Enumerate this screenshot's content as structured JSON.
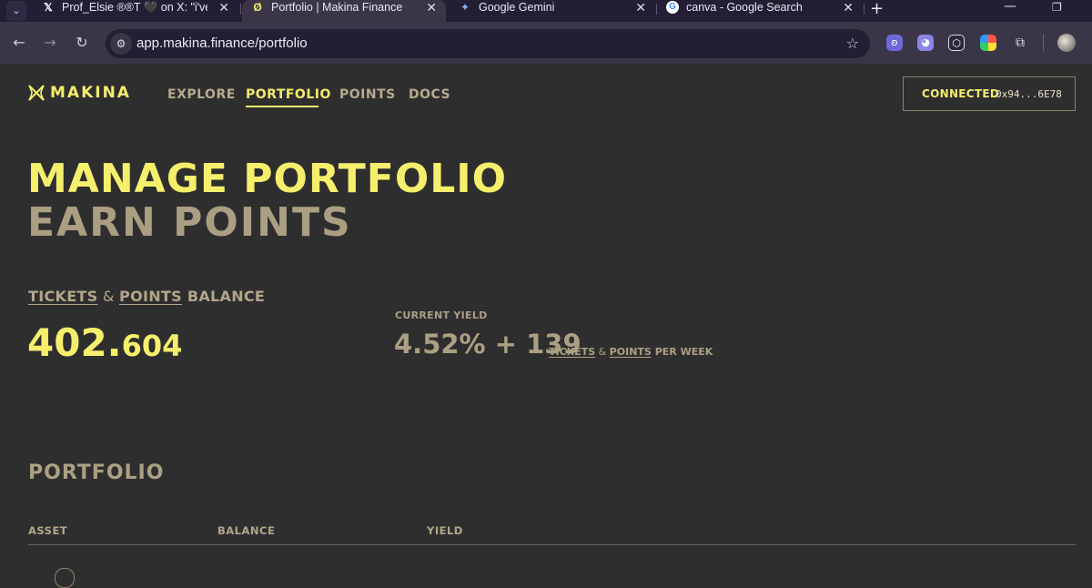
{
  "browser": {
    "tabs": [
      {
        "title": "Prof_Elsie ®®T 🖤 on X: \"i've be",
        "favicon": "x-logo-icon",
        "active": false
      },
      {
        "title": "Portfolio | Makina Finance",
        "favicon": "makina-logo-icon",
        "active": true
      },
      {
        "title": "Google Gemini",
        "favicon": "gemini-icon",
        "active": false
      },
      {
        "title": "canva - Google Search",
        "favicon": "google-icon",
        "active": false
      }
    ],
    "close_glyph": "✕",
    "new_tab_glyph": "+",
    "url": "app.makina.finance/portfolio",
    "extensions": [
      "bunny-extension-icon",
      "ghost-extension-icon",
      "hex-extension-icon",
      "rainbow-extension-icon",
      "puzzle-extensions-icon"
    ]
  },
  "site": {
    "logo_text": "MAKINA",
    "nav": [
      {
        "label": "EXPLORE",
        "active": false
      },
      {
        "label": "PORTFOLIO",
        "active": true
      },
      {
        "label": "POINTS",
        "active": false
      },
      {
        "label": "DOCS",
        "active": false
      }
    ],
    "connect": {
      "label": "CONNECTED",
      "address": "0x94...6E78"
    }
  },
  "hero": {
    "line1": "MANAGE PORTFOLIO",
    "line2": "EARN POINTS"
  },
  "balance": {
    "label_tickets": "TICKETS",
    "label_amp": " & ",
    "label_points": "POINTS",
    "label_rest": " BALANCE",
    "value_int": "402.",
    "value_dec": "604"
  },
  "yield": {
    "label": "CURRENT YIELD",
    "value": "4.52% + 139",
    "suffix_tickets": "TICKETS",
    "suffix_amp": " & ",
    "suffix_points": "POINTS",
    "suffix_rest": " PER WEEK"
  },
  "portfolio": {
    "heading": "PORTFOLIO",
    "columns": [
      "ASSET",
      "BALANCE",
      "YIELD"
    ]
  },
  "colors": {
    "accent": "#f3ec6e",
    "muted": "#aba083",
    "background": "#2f2e2f"
  }
}
